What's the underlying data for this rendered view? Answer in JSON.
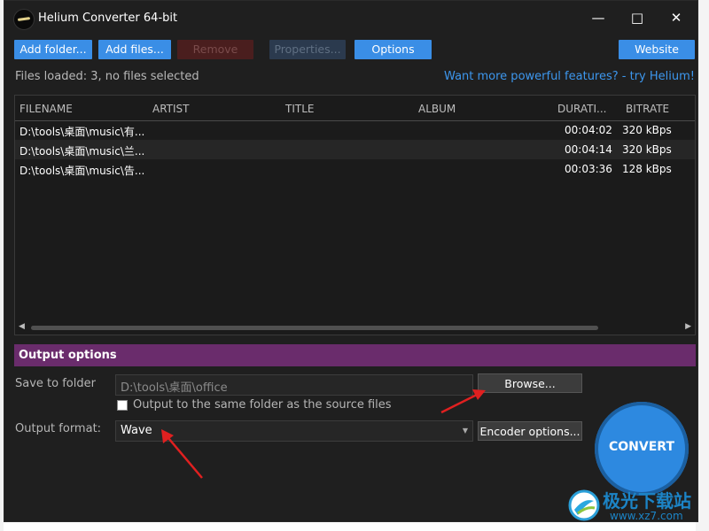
{
  "window": {
    "title": "Helium Converter 64-bit"
  },
  "toolbar": {
    "add_folder": "Add folder...",
    "add_files": "Add files...",
    "remove": "Remove",
    "properties": "Properties...",
    "options": "Options",
    "website": "Website"
  },
  "status": {
    "files_loaded": "Files loaded: 3, no files selected",
    "promo": "Want more powerful features? - try Helium!"
  },
  "table": {
    "columns": [
      "FILENAME",
      "ARTIST",
      "TITLE",
      "ALBUM",
      "DURATI...",
      "BITRATE"
    ],
    "rows": [
      {
        "filename": "D:\\tools\\桌面\\music\\有...",
        "duration": "00:04:02",
        "bitrate": "320 kBps"
      },
      {
        "filename": "D:\\tools\\桌面\\music\\兰...",
        "duration": "00:04:14",
        "bitrate": "320 kBps"
      },
      {
        "filename": "D:\\tools\\桌面\\music\\告...",
        "duration": "00:03:36",
        "bitrate": "128 kBps"
      }
    ]
  },
  "output": {
    "header": "Output options",
    "save_label": "Save to folder",
    "folder_value": "D:\\tools\\桌面\\office",
    "browse": "Browse...",
    "same_folder_label": "Output to the same folder as the source files",
    "same_folder_checked": false,
    "format_label": "Output format:",
    "format_value": "Wave",
    "encoder_options": "Encoder options...",
    "convert": "CONVERT"
  },
  "watermark": {
    "text": "极光下载站",
    "url": "www.xz7.com"
  },
  "colors": {
    "accent": "#3a8ee6",
    "output_header": "#6a2c6c",
    "convert": "#2d89e0",
    "annotation": "#e02020"
  }
}
